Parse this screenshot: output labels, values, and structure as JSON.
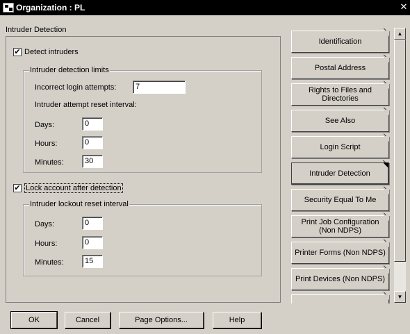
{
  "window": {
    "title": "Organization : PL",
    "close_glyph": "✕"
  },
  "page": {
    "heading": "Intruder Detection"
  },
  "detect": {
    "label": "Detect intruders",
    "checked": true,
    "group_label": "Intruder detection limits",
    "incorrect_login_label": "Incorrect login attempts:",
    "incorrect_login_value": "7",
    "reset_interval_label": "Intruder attempt reset interval:",
    "days_label": "Days:",
    "days_value": "0",
    "hours_label": "Hours:",
    "hours_value": "0",
    "minutes_label": "Minutes:",
    "minutes_value": "30"
  },
  "lock": {
    "label": "Lock account after detection",
    "checked": true,
    "group_label": "Intruder lockout reset interval",
    "days_label": "Days:",
    "days_value": "0",
    "hours_label": "Hours:",
    "hours_value": "0",
    "minutes_label": "Minutes:",
    "minutes_value": "15"
  },
  "tabs": [
    {
      "label": "Identification",
      "active": false
    },
    {
      "label": "Postal Address",
      "active": false
    },
    {
      "label": "Rights to Files and Directories",
      "active": false
    },
    {
      "label": "See Also",
      "active": false
    },
    {
      "label": "Login Script",
      "active": false
    },
    {
      "label": "Intruder Detection",
      "active": true
    },
    {
      "label": "Security Equal To Me",
      "active": false
    },
    {
      "label": "Print Job Configuration (Non NDPS)",
      "active": false
    },
    {
      "label": "Printer Forms (Non NDPS)",
      "active": false
    },
    {
      "label": "Print Devices (Non NDPS)",
      "active": false
    }
  ],
  "scrollbar": {
    "up_glyph": "▲",
    "down_glyph": "▼"
  },
  "buttons": {
    "ok": "OK",
    "cancel": "Cancel",
    "page_options": "Page Options...",
    "help": "Help"
  },
  "colors": {
    "face": "#d4d0c8",
    "titlebar": "#000000",
    "field": "#ffffff"
  }
}
